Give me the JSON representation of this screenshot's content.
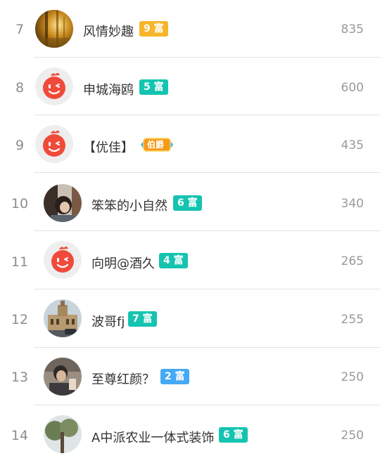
{
  "colors": {
    "rich_badge_orange": "#f7b52c",
    "rich_badge_teal": "#14c4b0",
    "rich_badge_blue": "#45a9f3",
    "rank_text": "#8e8e8e",
    "score_text": "#999999",
    "name_text": "#333333",
    "default_avatar_red": "#f04a3b"
  },
  "rows": [
    {
      "rank": "7",
      "name": "风情妙趣",
      "badge_num": "9",
      "badge_label": "富",
      "badge_color": "#f7b52c",
      "score": "835",
      "avatar": "forest-photo"
    },
    {
      "rank": "8",
      "name": "申城海鸥",
      "badge_num": "5",
      "badge_label": "富",
      "badge_color": "#14c4b0",
      "score": "600",
      "avatar": "default-wink"
    },
    {
      "rank": "9",
      "name": "【优佳】",
      "title_badge": "伯爵",
      "score": "435",
      "avatar": "default-wink"
    },
    {
      "rank": "10",
      "name": "笨笨的小自然",
      "badge_num": "6",
      "badge_label": "富",
      "badge_color": "#14c4b0",
      "score": "340",
      "avatar": "person-photo"
    },
    {
      "rank": "11",
      "name": "向明@酒久",
      "badge_num": "4",
      "badge_label": "富",
      "badge_color": "#14c4b0",
      "score": "265",
      "avatar": "default-wink"
    },
    {
      "rank": "12",
      "name": "波哥fj",
      "badge_num": "7",
      "badge_label": "富",
      "badge_color": "#14c4b0",
      "score": "255",
      "avatar": "building-photo"
    },
    {
      "rank": "13",
      "name": "至尊红颜？",
      "badge_num": "2",
      "badge_label": "富",
      "badge_color": "#45a9f3",
      "score": "250",
      "avatar": "person-photo-2"
    },
    {
      "rank": "14",
      "name": "A中派农业一体式装饰",
      "badge_num": "6",
      "badge_label": "富",
      "badge_color": "#14c4b0",
      "score": "250",
      "avatar": "tree-photo"
    }
  ]
}
